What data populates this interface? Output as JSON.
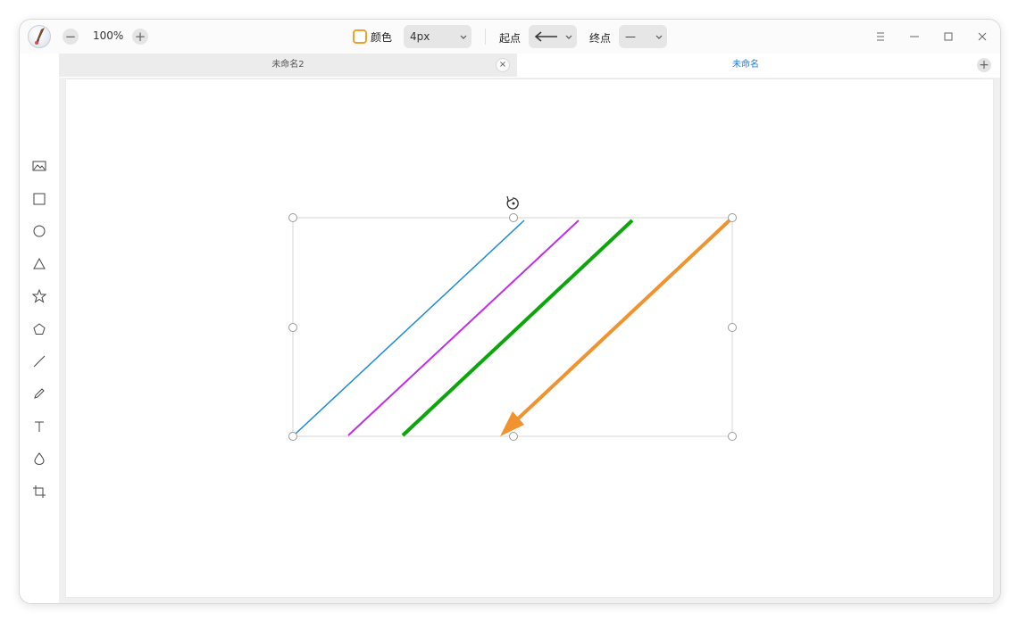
{
  "toolbar_top": {
    "zoom_level": "100%",
    "zoom_out_symbol": "−",
    "zoom_in_symbol": "+",
    "color_label": "颜色",
    "stroke_width": "4px",
    "start_label": "起点",
    "end_label": "终点",
    "end_value": "—"
  },
  "tabs": [
    {
      "label": "未命名2",
      "active": false
    },
    {
      "label": "未命名",
      "active": true
    }
  ],
  "tab_close_symbol": "×",
  "tab_add_symbol": "+",
  "side_tools": [
    "image-icon",
    "rectangle-icon",
    "ellipse-icon",
    "triangle-icon",
    "star-icon",
    "polygon-icon",
    "line-icon",
    "pencil-icon",
    "text-icon",
    "blur-icon",
    "crop-icon"
  ],
  "colors": {
    "accent": "#1d7cd6",
    "line_blue": "#1a8ad4",
    "line_purple": "#c02ee6",
    "line_green": "#0aa60a",
    "line_orange": "#f0922e",
    "selected_color": "#f0a030"
  }
}
